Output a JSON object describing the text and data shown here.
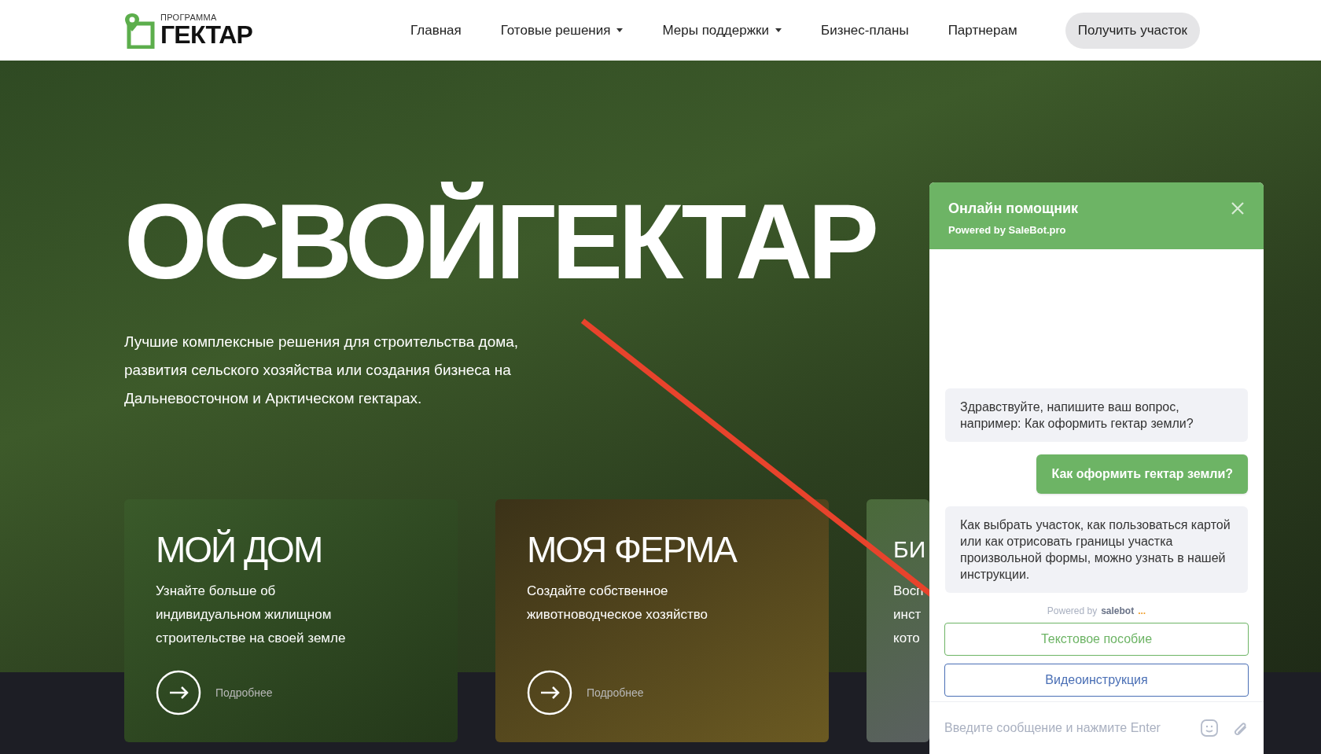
{
  "header": {
    "logo": {
      "small": "ПРОГРАММА",
      "big": "ГЕКТАР"
    },
    "nav": [
      {
        "label": "Главная",
        "dropdown": false
      },
      {
        "label": "Готовые решения",
        "dropdown": true
      },
      {
        "label": "Меры поддержки",
        "dropdown": true
      },
      {
        "label": "Бизнес-планы",
        "dropdown": false
      },
      {
        "label": "Партнерам",
        "dropdown": false
      }
    ],
    "cta": "Получить участок"
  },
  "hero": {
    "title": "ОСВОЙГЕКТАР",
    "subtitle": "Лучшие комплексные решения для строительства дома, развития сельского хозяйства или создания бизнеса на Дальневосточном и Арктическом гектарах."
  },
  "cards": [
    {
      "title": "МОЙ ДОМ",
      "description": "Узнайте больше об\nиндивидуальном жилищном\nстроительстве на своей земле",
      "link": "Подробнее"
    },
    {
      "title": "МОЯ ФЕРМА",
      "description": "Создайте собственное\nживотноводческое хозяйство",
      "link": "Подробнее"
    },
    {
      "title": "БИ",
      "description": "Восп\nинст\nкото"
    }
  ],
  "chat": {
    "title": "Онлайн помощник",
    "subtitle": "Powered by SaleBot.pro",
    "messages": [
      {
        "kind": "bot",
        "text": "Здравствуйте, напишите ваш вопрос, например: Как оформить гектар земли?"
      },
      {
        "kind": "user",
        "text": "Как оформить гектар земли?"
      },
      {
        "kind": "bot",
        "text": "Как выбрать участок, как пользоваться картой или как отрисовать границы участка произвольной формы, можно узнать в нашей инструкции."
      }
    ],
    "powered": {
      "prefix": "Powered by",
      "brand": "salebot",
      "dots": "..."
    },
    "buttons": [
      {
        "label": "Текстовое пособие",
        "color": "#6db465"
      },
      {
        "label": "Видеоинструкция",
        "color": "#4a6fb5"
      }
    ],
    "input": {
      "placeholder": "Введите сообщение и нажмите Enter"
    }
  }
}
